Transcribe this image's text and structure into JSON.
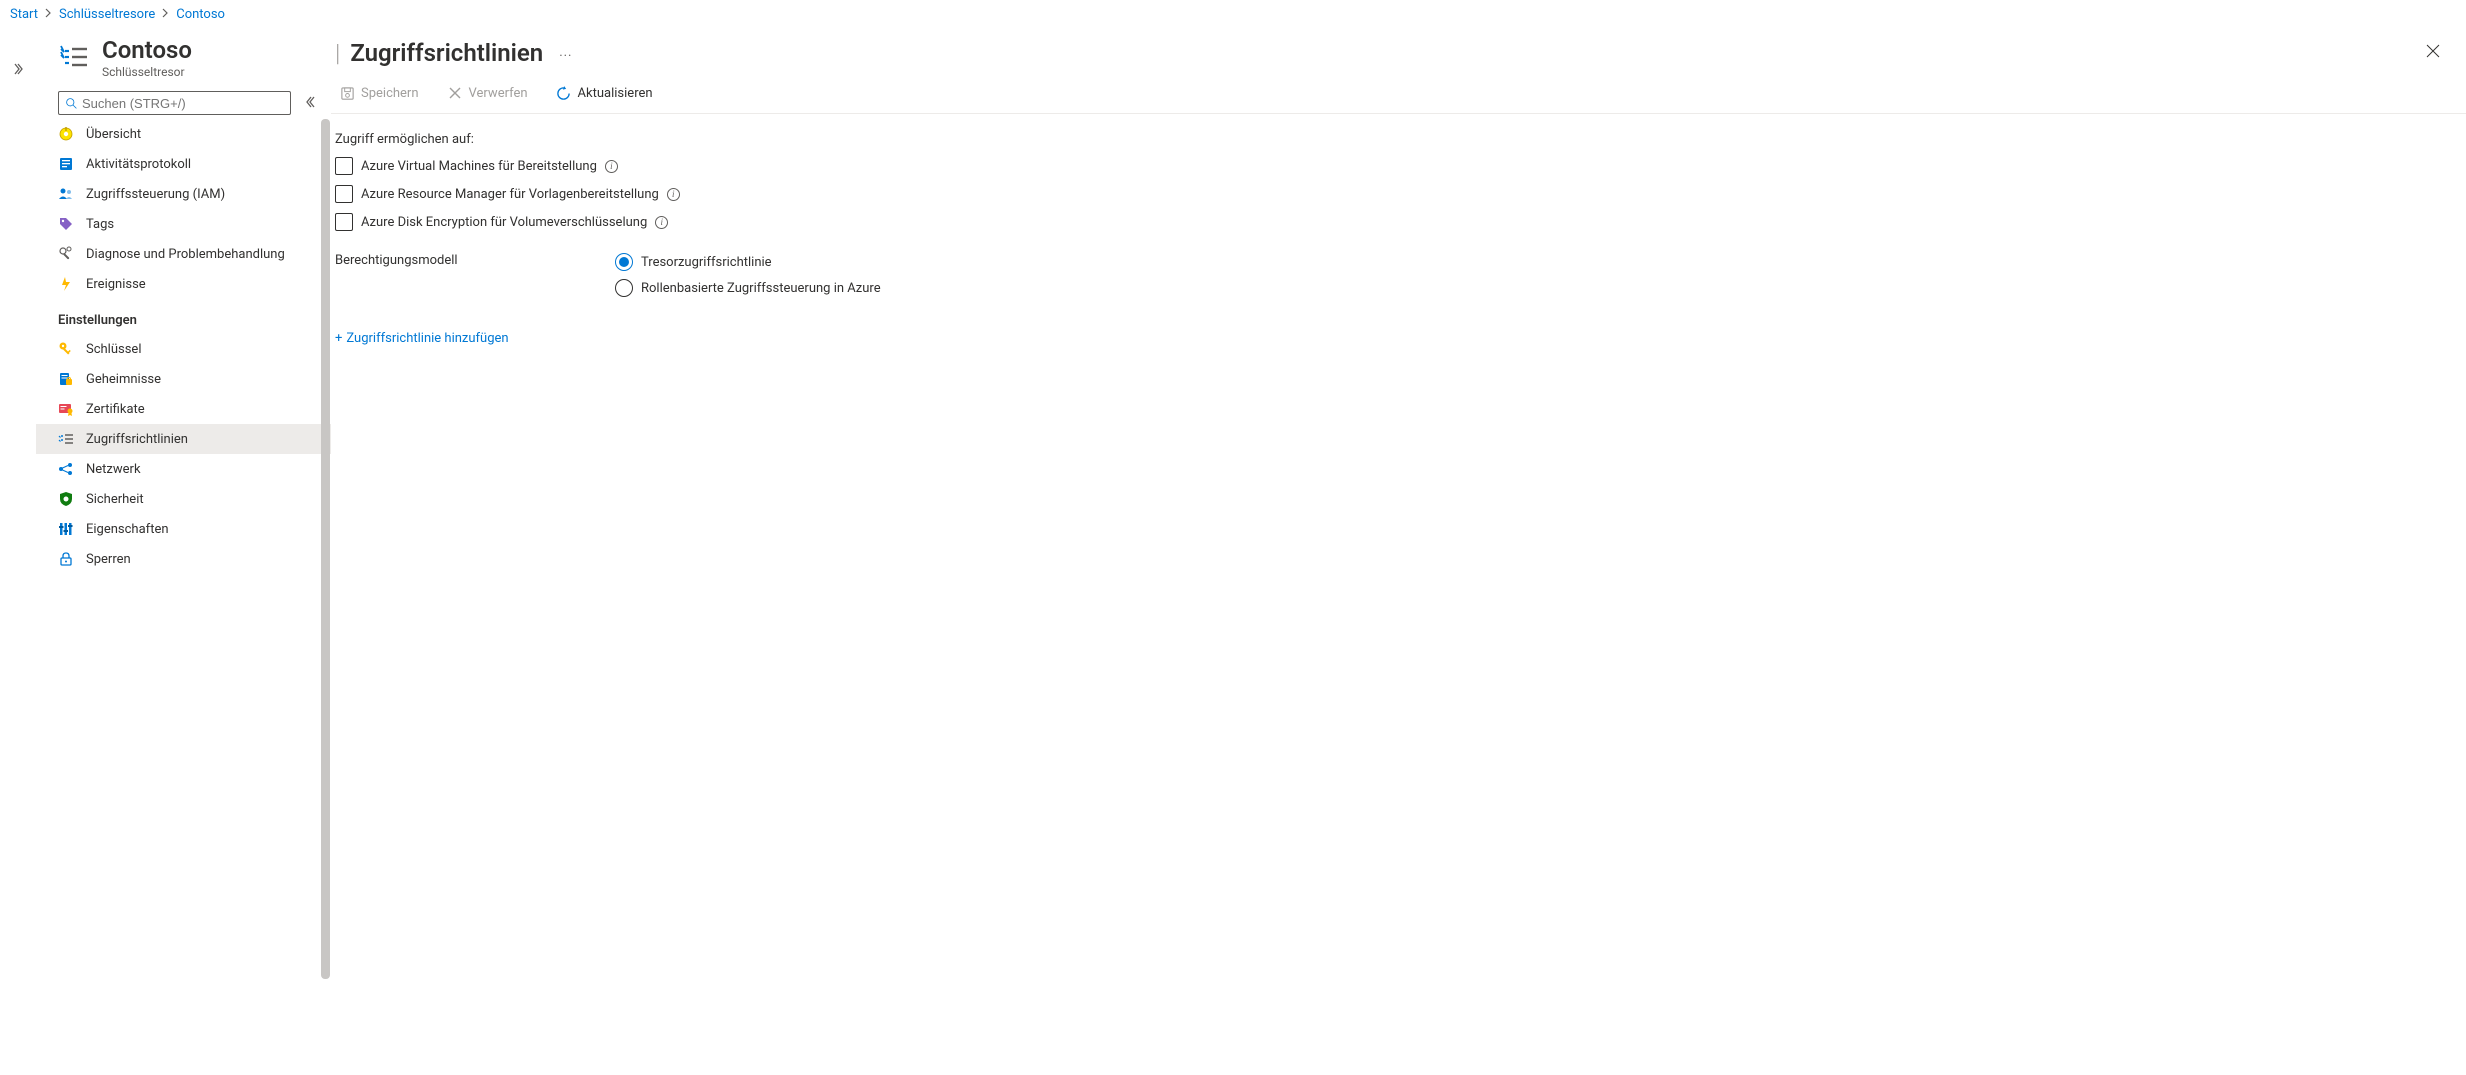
{
  "breadcrumb": {
    "items": [
      "Start",
      "Schlüsseltresore",
      "Contoso"
    ]
  },
  "resource": {
    "title": "Contoso",
    "subtitle": "Schlüsseltresor"
  },
  "search": {
    "placeholder": "Suchen (STRG+/)"
  },
  "nav": {
    "top": [
      {
        "label": "Übersicht",
        "icon": "overview"
      },
      {
        "label": "Aktivitätsprotokoll",
        "icon": "activity"
      },
      {
        "label": "Zugriffssteuerung (IAM)",
        "icon": "iam"
      },
      {
        "label": "Tags",
        "icon": "tags"
      },
      {
        "label": "Diagnose und Problembehandlung",
        "icon": "diagnose"
      },
      {
        "label": "Ereignisse",
        "icon": "events"
      }
    ],
    "settings_label": "Einstellungen",
    "settings": [
      {
        "label": "Schlüssel",
        "icon": "keys"
      },
      {
        "label": "Geheimnisse",
        "icon": "secrets"
      },
      {
        "label": "Zertifikate",
        "icon": "certificates"
      },
      {
        "label": "Zugriffsrichtlinien",
        "icon": "policies",
        "selected": true
      },
      {
        "label": "Netzwerk",
        "icon": "network"
      },
      {
        "label": "Sicherheit",
        "icon": "security"
      },
      {
        "label": "Eigenschaften",
        "icon": "properties"
      },
      {
        "label": "Sperren",
        "icon": "locks"
      }
    ]
  },
  "panel": {
    "title": "Zugriffsrichtlinien"
  },
  "toolbar": {
    "save": "Speichern",
    "discard": "Verwerfen",
    "refresh": "Aktualisieren"
  },
  "content": {
    "enable_access_label": "Zugriff ermöglichen auf:",
    "checkboxes": [
      "Azure Virtual Machines für Bereitstellung",
      "Azure Resource Manager für Vorlagenbereitstellung",
      "Azure Disk Encryption für Volumeverschlüsselung"
    ],
    "permission_model_label": "Berechtigungsmodell",
    "radios": [
      {
        "label": "Tresorzugriffsrichtlinie",
        "checked": true
      },
      {
        "label": "Rollenbasierte Zugriffssteuerung in Azure",
        "checked": false
      }
    ],
    "add_policy": "Zugriffsrichtlinie hinzufügen"
  }
}
